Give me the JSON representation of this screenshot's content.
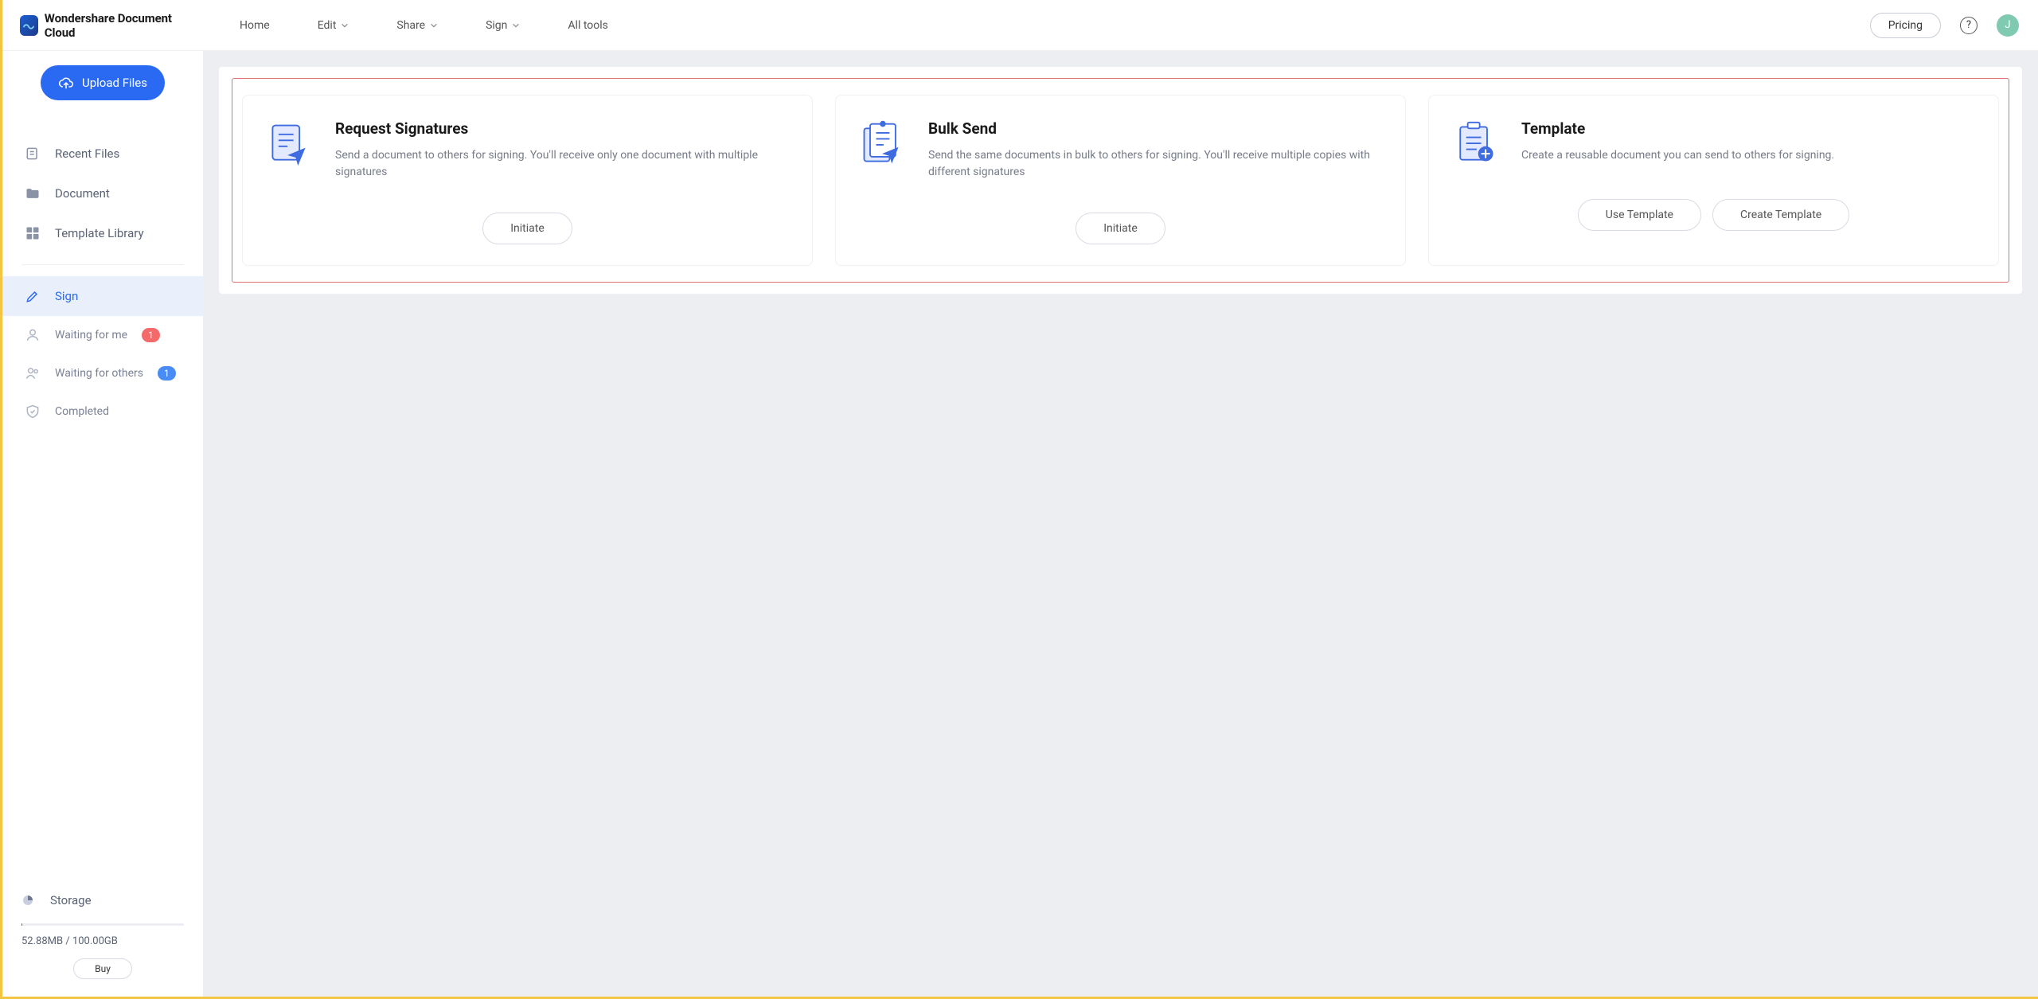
{
  "header": {
    "brand": "Wondershare Document Cloud",
    "nav": {
      "home": "Home",
      "edit": "Edit",
      "share": "Share",
      "sign": "Sign",
      "alltools": "All tools"
    },
    "pricing": "Pricing",
    "avatar_initial": "J"
  },
  "sidebar": {
    "upload": "Upload Files",
    "recent": "Recent Files",
    "document": "Document",
    "template_library": "Template Library",
    "sign": "Sign",
    "waiting_me": "Waiting for me",
    "waiting_me_badge": "1",
    "waiting_others": "Waiting for others",
    "waiting_others_badge": "1",
    "completed": "Completed",
    "storage_label": "Storage",
    "storage_text": "52.88MB / 100.00GB",
    "buy": "Buy"
  },
  "cards": {
    "request": {
      "title": "Request Signatures",
      "desc": "Send a document to others for signing. You'll receive only one document with multiple signatures",
      "btn": "Initiate"
    },
    "bulk": {
      "title": "Bulk Send",
      "desc": "Send the same documents in bulk to others for signing. You'll receive multiple copies with different signatures",
      "btn": "Initiate"
    },
    "template": {
      "title": "Template",
      "desc": "Create a reusable document you can send to others for signing.",
      "btn_use": "Use Template",
      "btn_create": "Create Template"
    }
  }
}
